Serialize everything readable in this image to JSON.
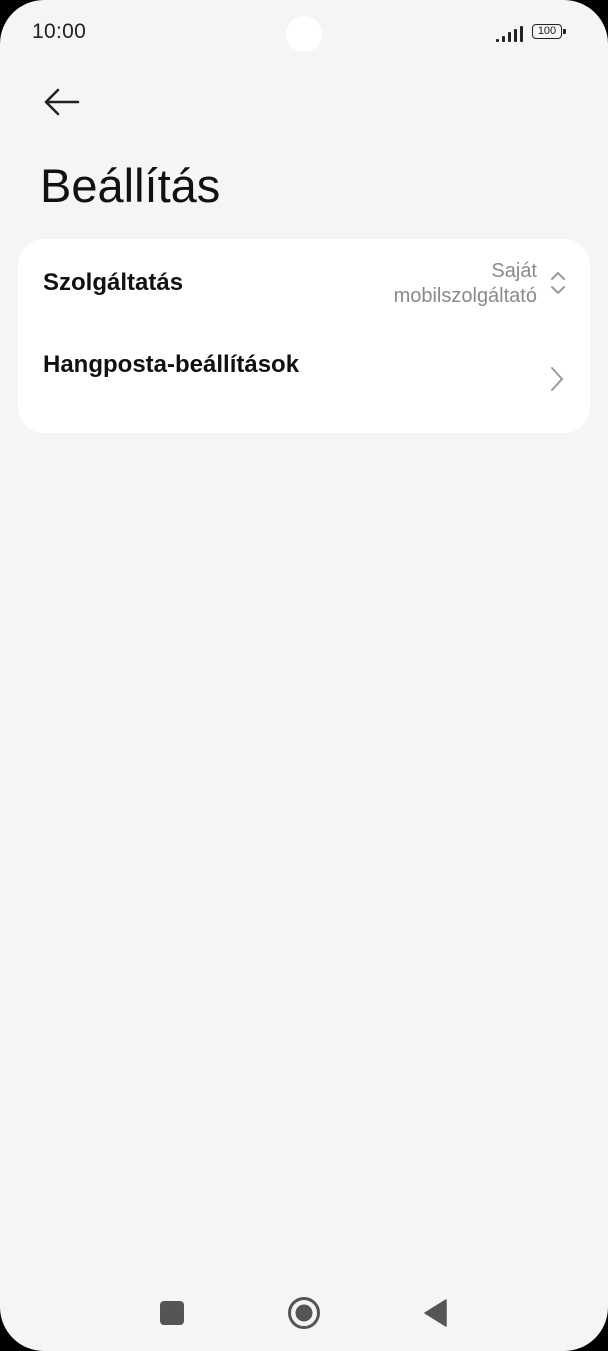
{
  "status_bar": {
    "time": "10:00",
    "battery_level": "100"
  },
  "header": {
    "back_icon": "arrow-left-icon",
    "title": "Beállítás"
  },
  "settings": {
    "service": {
      "label": "Szolgáltatás",
      "value_line1": "Saját",
      "value_line2": "mobilszolgáltató",
      "icon": "chevron-up-down-icon"
    },
    "voicemail": {
      "label": "Hangposta-beállítások",
      "icon": "chevron-right-icon"
    }
  },
  "nav_bar": {
    "recent_icon": "square-icon",
    "home_icon": "circle-icon",
    "back_icon": "triangle-back-icon"
  },
  "colors": {
    "background": "#f5f5f5",
    "card": "#ffffff",
    "text_primary": "#111111",
    "text_secondary": "#8a8a8a"
  }
}
